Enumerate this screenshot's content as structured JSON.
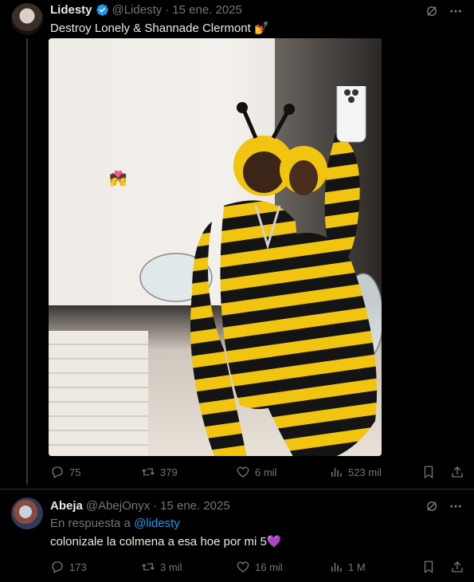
{
  "tweet": {
    "author_name": "Lidesty",
    "author_handle": "@Lidesty",
    "separator": "·",
    "date": "15 ene. 2025",
    "text": "Destroy Lonely & Shannade Clermont 💅",
    "sticker": "💏",
    "stats": {
      "replies": "75",
      "retweets": "379",
      "likes": "6 mil",
      "views": "523 mil"
    }
  },
  "reply": {
    "author_name": "Abeja",
    "author_handle": "@AbejOnyx",
    "separator": "·",
    "date": "15 ene. 2025",
    "reply_prefix": "En respuesta a",
    "reply_target": "@lidesty",
    "text": "colonizale la colmena a esa hoe por mi 5💜",
    "stats": {
      "replies": "173",
      "retweets": "3 mil",
      "likes": "16 mil",
      "views": "1 M"
    }
  },
  "colors": {
    "background": "#000000",
    "text": "#e7e9ea",
    "muted": "#71767b",
    "accent": "#1d9bf0"
  },
  "icons": [
    "verified-badge-icon",
    "grok-icon",
    "more-icon",
    "reply-icon",
    "retweet-icon",
    "like-icon",
    "views-icon",
    "bookmark-icon",
    "share-icon"
  ]
}
